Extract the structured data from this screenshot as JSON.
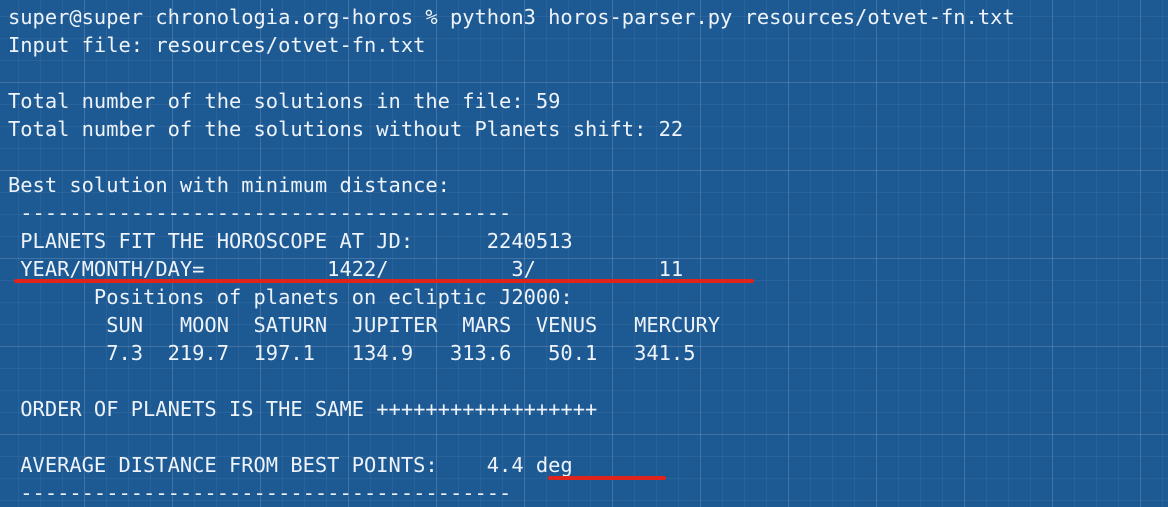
{
  "terminal": {
    "lines": [
      "super@super chronologia.org-horos % python3 horos-parser.py resources/otvet-fn.txt",
      "Input file: resources/otvet-fn.txt",
      "",
      "Total number of the solutions in the file: 59",
      "Total number of the solutions without Planets shift: 22",
      "",
      "Best solution with minimum distance:",
      " ----------------------------------------",
      " PLANETS FIT THE HOROSCOPE AT JD:      2240513",
      " YEAR/MONTH/DAY=          1422/          3/          11",
      "       Positions of planets on ecliptic J2000:",
      "        SUN   MOON  SATURN  JUPITER  MARS  VENUS   MERCURY",
      "        7.3  219.7  197.1   134.9   313.6   50.1   341.5",
      "",
      " ORDER OF PLANETS IS THE SAME ++++++++++++++++++",
      "",
      " AVERAGE DISTANCE FROM BEST POINTS:    4.4 deg",
      " ----------------------------------------"
    ]
  },
  "colors": {
    "background": "#1d5a94",
    "text": "#eef3fa",
    "underline": "#e0231b"
  }
}
